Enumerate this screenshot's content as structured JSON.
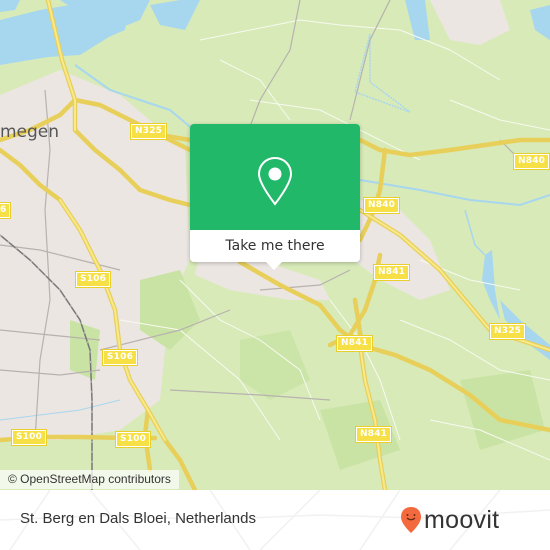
{
  "map": {
    "city_label": "megen",
    "road_labels": [
      {
        "text": "N325",
        "id": "n325-top"
      },
      {
        "text": "N840",
        "id": "n840-right"
      },
      {
        "text": "N840",
        "id": "n840-mid"
      },
      {
        "text": "N841",
        "id": "n841-mid"
      },
      {
        "text": "N325",
        "id": "n325-right"
      },
      {
        "text": "N841",
        "id": "n841-south"
      },
      {
        "text": "N841",
        "id": "n841-bottom"
      },
      {
        "text": "S106",
        "id": "s106-top"
      },
      {
        "text": "S106",
        "id": "s106-bottom"
      },
      {
        "text": "S100",
        "id": "s100-left"
      },
      {
        "text": "S100",
        "id": "s100-right"
      },
      {
        "text": "6",
        "id": "s-edge-left"
      }
    ],
    "attribution": "© OpenStreetMap contributors"
  },
  "popup": {
    "icon": "map-pin-icon",
    "button_label": "Take me there",
    "accent_color": "#21b86a"
  },
  "footer": {
    "place_name": "St. Berg en Dals Bloei, Netherlands",
    "brand": "moovit",
    "brand_color": "#f26a3d"
  }
}
